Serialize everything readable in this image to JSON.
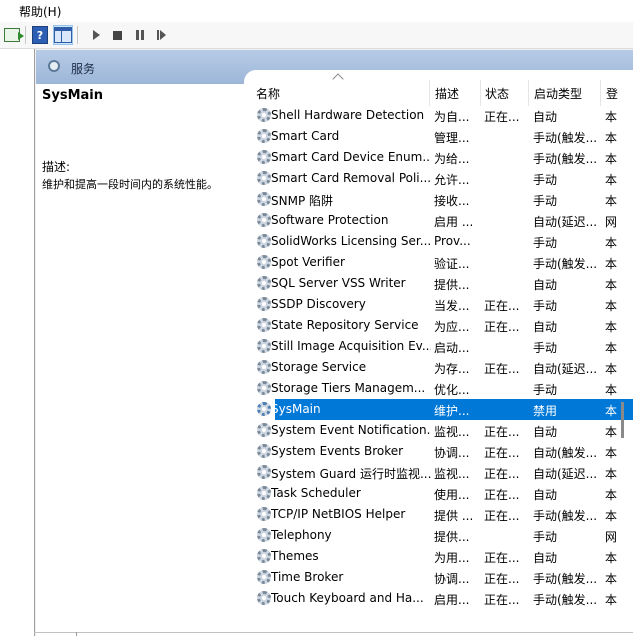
{
  "menu": {
    "fragment": ")",
    "help": "帮助(H)"
  },
  "toolbar": {
    "icons": [
      "export-icon",
      "help-icon",
      "view-icon",
      "play-icon",
      "stop-icon",
      "pause-icon",
      "restart-icon"
    ]
  },
  "panel": {
    "title": "服务"
  },
  "description": {
    "service_name": "SysMain",
    "label": "描述:",
    "text": "维护和提高一段时间内的系统性能。"
  },
  "columns": {
    "name": "名称",
    "description": "描述",
    "status": "状态",
    "startup": "启动类型",
    "logon": "登"
  },
  "services": [
    {
      "name": "Shell Hardware Detection",
      "desc": "为自...",
      "status": "正在...",
      "startup": "自动",
      "logon": "本"
    },
    {
      "name": "Smart Card",
      "desc": "管理...",
      "status": "",
      "startup": "手动(触发...",
      "logon": "本"
    },
    {
      "name": "Smart Card Device Enum...",
      "desc": "为给...",
      "status": "",
      "startup": "手动(触发...",
      "logon": "本"
    },
    {
      "name": "Smart Card Removal Poli...",
      "desc": "允许...",
      "status": "",
      "startup": "手动",
      "logon": "本"
    },
    {
      "name": "SNMP 陷阱",
      "desc": "接收...",
      "status": "",
      "startup": "手动",
      "logon": "本"
    },
    {
      "name": "Software Protection",
      "desc": "启用 ...",
      "status": "",
      "startup": "自动(延迟...",
      "logon": "网"
    },
    {
      "name": "SolidWorks Licensing Ser...",
      "desc": "Prov...",
      "status": "",
      "startup": "手动",
      "logon": "本"
    },
    {
      "name": "Spot Verifier",
      "desc": "验证...",
      "status": "",
      "startup": "手动(触发...",
      "logon": "本"
    },
    {
      "name": "SQL Server VSS Writer",
      "desc": "提供...",
      "status": "",
      "startup": "自动",
      "logon": "本"
    },
    {
      "name": "SSDP Discovery",
      "desc": "当发...",
      "status": "正在...",
      "startup": "手动",
      "logon": "本"
    },
    {
      "name": "State Repository Service",
      "desc": "为应...",
      "status": "正在...",
      "startup": "自动",
      "logon": "本"
    },
    {
      "name": "Still Image Acquisition Ev...",
      "desc": "启动...",
      "status": "",
      "startup": "手动",
      "logon": "本"
    },
    {
      "name": "Storage Service",
      "desc": "为存...",
      "status": "正在...",
      "startup": "自动(延迟...",
      "logon": "本"
    },
    {
      "name": "Storage Tiers Managem...",
      "desc": "优化...",
      "status": "",
      "startup": "手动",
      "logon": "本"
    },
    {
      "name": "SysMain",
      "desc": "维护...",
      "status": "",
      "startup": "禁用",
      "logon": "本",
      "selected": true
    },
    {
      "name": "System Event Notification...",
      "desc": "监视...",
      "status": "正在...",
      "startup": "自动",
      "logon": "本"
    },
    {
      "name": "System Events Broker",
      "desc": "协调...",
      "status": "正在...",
      "startup": "自动(触发...",
      "logon": "本"
    },
    {
      "name": "System Guard 运行时监视...",
      "desc": "监视...",
      "status": "正在...",
      "startup": "自动(延迟...",
      "logon": "本"
    },
    {
      "name": "Task Scheduler",
      "desc": "使用...",
      "status": "正在...",
      "startup": "自动",
      "logon": "本"
    },
    {
      "name": "TCP/IP NetBIOS Helper",
      "desc": "提供 ...",
      "status": "正在...",
      "startup": "手动(触发...",
      "logon": "本"
    },
    {
      "name": "Telephony",
      "desc": "提供...",
      "status": "",
      "startup": "手动",
      "logon": "网"
    },
    {
      "name": "Themes",
      "desc": "为用...",
      "status": "正在...",
      "startup": "自动",
      "logon": "本"
    },
    {
      "name": "Time Broker",
      "desc": "协调...",
      "status": "正在...",
      "startup": "手动(触发...",
      "logon": "本"
    },
    {
      "name": "Touch Keyboard and Ha...",
      "desc": "启用...",
      "status": "正在...",
      "startup": "手动(触发...",
      "logon": "本"
    }
  ]
}
